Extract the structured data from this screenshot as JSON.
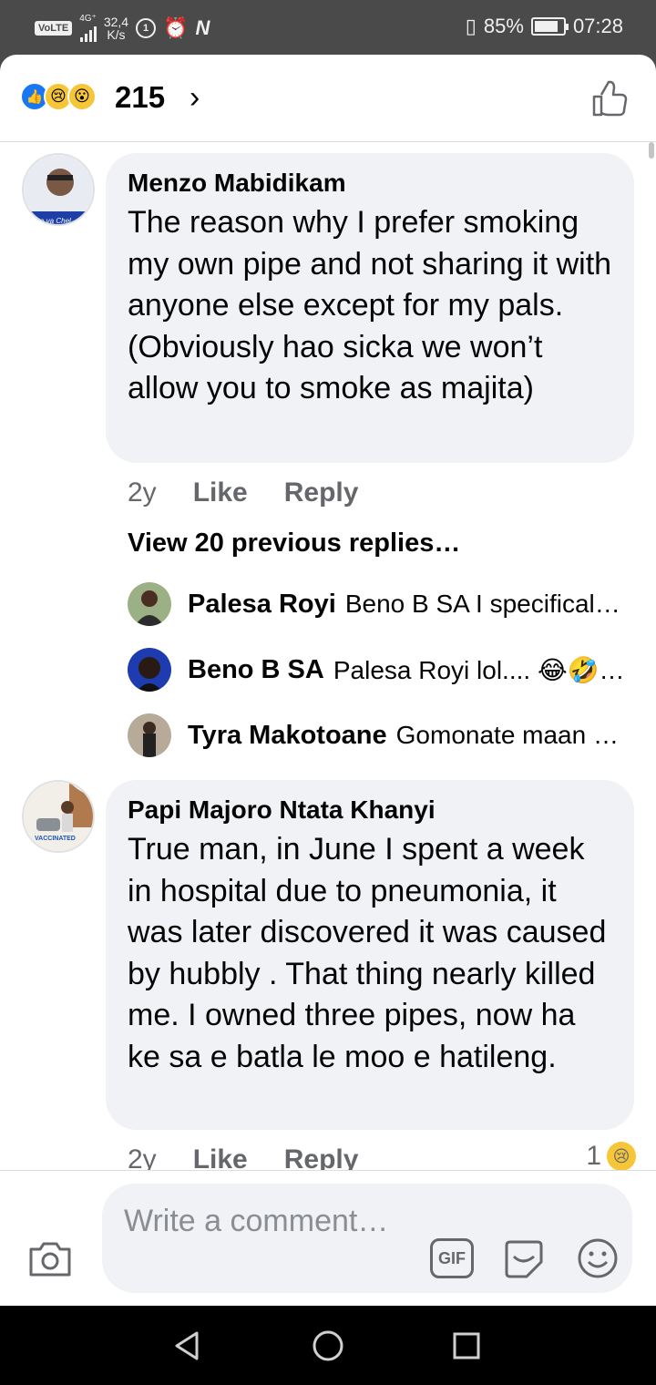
{
  "status_bar": {
    "volte": "VoLTE",
    "network_type": "4G⁺",
    "data_speed_value": "32,4",
    "data_speed_unit": "K/s",
    "carrier_icon_letter": "N",
    "battery_percent": "85%",
    "battery_level": 0.85,
    "time": "07:28"
  },
  "reactions": {
    "icons": [
      "like-icon",
      "sad-icon",
      "wow-icon"
    ],
    "count": "215",
    "chevron": "›"
  },
  "comments": [
    {
      "author": "Menzo Mabidikam",
      "text": "The reason why I prefer smoking my own pipe and not sharing it with anyone else except for my pals. (Obviously hao sicka we won’t allow you to smoke as majita)",
      "time": "2y",
      "like_label": "Like",
      "reply_label": "Reply",
      "avatar_caption": "e va Chel"
    },
    {
      "author": "Papi Majoro Ntata Khanyi",
      "text": "True man, in June I spent a week in hospital due to pneumonia, it was later discovered it was caused by hubbly . That thing nearly killed me. I owned three pipes, now ha ke sa e batla le moo e hatileng.",
      "time": "2y",
      "like_label": "Like",
      "reply_label": "Reply",
      "avatar_caption": "VACCINATED",
      "reaction_count": "1"
    }
  ],
  "replies_section": {
    "view_previous": "View 20 previous replies…",
    "replies": [
      {
        "author": "Palesa Royi",
        "text": "Beno B SA I specifical…"
      },
      {
        "author": "Beno B SA",
        "text": "Palesa Royi lol.... 😂🤣…"
      },
      {
        "author": "Tyra Makotoane",
        "text": "Gomonate maan …"
      }
    ]
  },
  "composer": {
    "placeholder": "Write a comment…",
    "gif_label": "GIF"
  },
  "colors": {
    "accent_blue": "#1877f2",
    "bubble_bg": "#f0f2f5",
    "meta_gray": "#65676b"
  }
}
